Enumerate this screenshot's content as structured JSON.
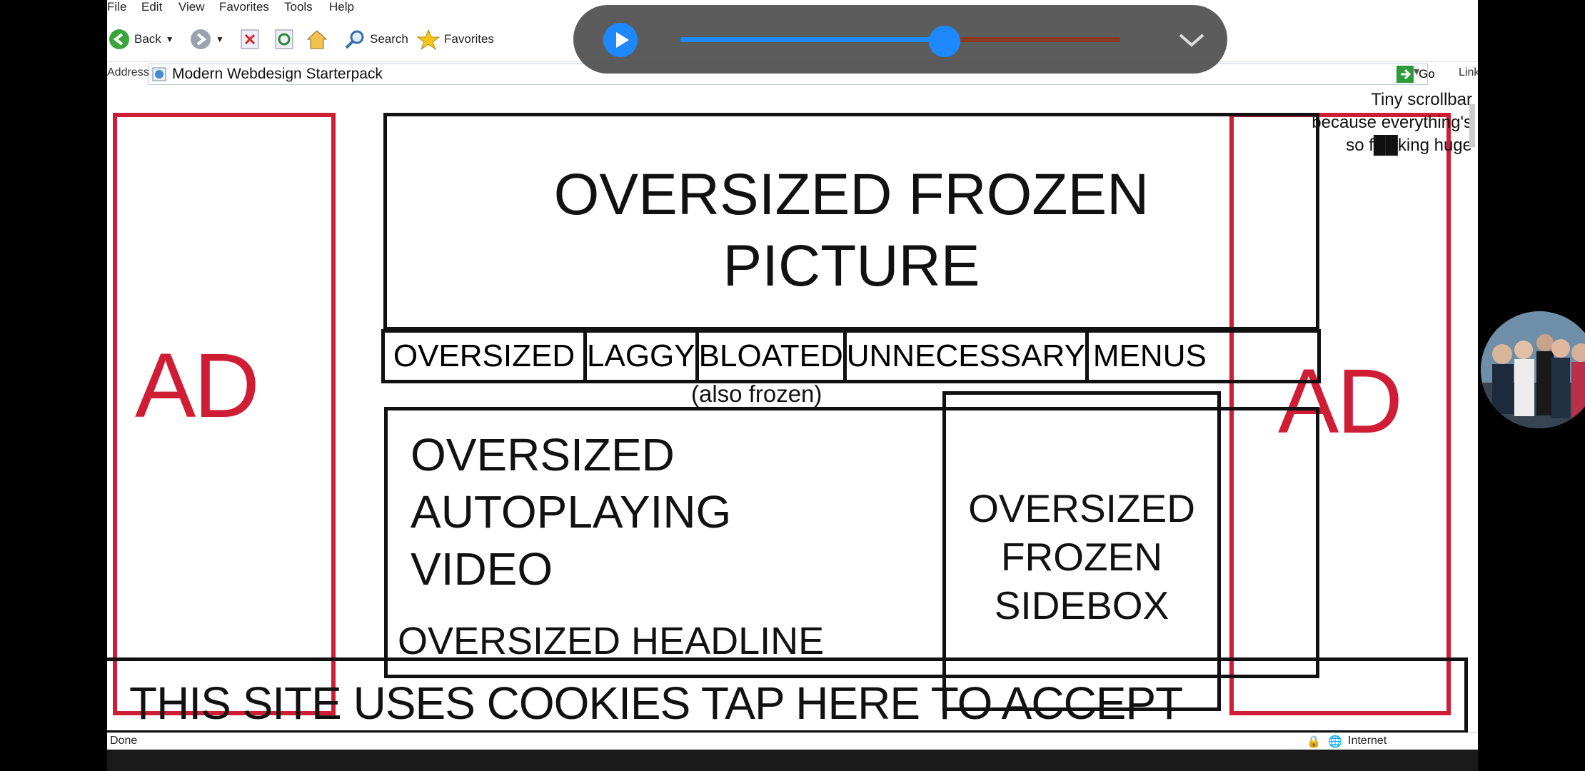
{
  "browser": {
    "menu": [
      "File",
      "Edit",
      "View",
      "Favorites",
      "Tools",
      "Help"
    ],
    "toolbar": {
      "back": "Back",
      "search": "Search",
      "favorites": "Favorites"
    },
    "address": {
      "label": "Address",
      "value": "Modern Webdesign Starterpack",
      "go": "Go",
      "links": "Links"
    },
    "status": {
      "left": "Done",
      "right": "Internet"
    }
  },
  "page": {
    "ad_left": "AD",
    "ad_right": "AD",
    "hero_line1": "OVERSIZED FROZEN",
    "hero_line2": "PICTURE",
    "menus": [
      "OVERSIZED",
      "LAGGY",
      "BLOATED",
      "UNNECESSARY",
      "MENUS"
    ],
    "menus_note": "(also frozen)",
    "video_line1": "OVERSIZED",
    "video_line2": "AUTOPLAYING",
    "video_line3": "VIDEO",
    "headline": "OVERSIZED HEADLINE",
    "sidebox_line1": "OVERSIZED",
    "sidebox_line2": "FROZEN",
    "sidebox_line3": "SIDEBOX",
    "cookie": "THIS SITE USES COOKIES TAP HERE TO ACCEPT",
    "scroll_note_1": "Tiny scrollbar",
    "scroll_note_2": "because everything's",
    "scroll_note_3": "so f██king huge"
  },
  "player": {
    "progress": 0.6,
    "accent": "#1e88ff"
  },
  "colors": {
    "ad_red": "#d01d36",
    "ink": "#111111"
  }
}
